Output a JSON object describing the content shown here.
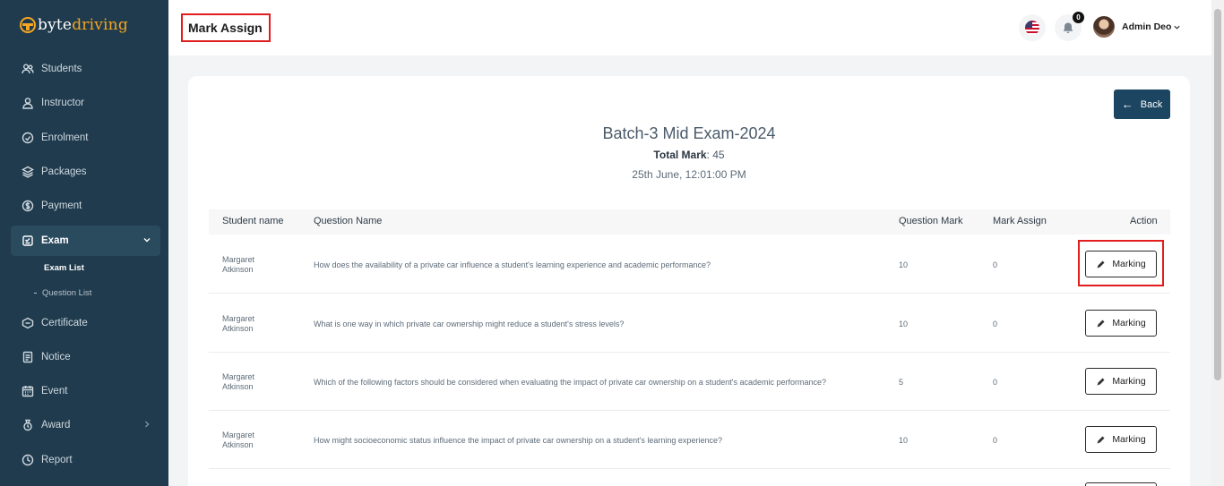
{
  "brand": {
    "part1": "byte",
    "part2": "driving"
  },
  "sidebar": {
    "items": [
      {
        "label": "Students",
        "icon": "users-icon"
      },
      {
        "label": "Instructor",
        "icon": "user-icon"
      },
      {
        "label": "Enrolment",
        "icon": "enrolment-icon"
      },
      {
        "label": "Packages",
        "icon": "layers-icon"
      },
      {
        "label": "Payment",
        "icon": "dollar-icon"
      },
      {
        "label": "Exam",
        "icon": "exam-icon"
      },
      {
        "label": "Certificate",
        "icon": "certificate-icon"
      },
      {
        "label": "Notice",
        "icon": "notice-icon"
      },
      {
        "label": "Event",
        "icon": "calendar-icon"
      },
      {
        "label": "Award",
        "icon": "award-icon"
      },
      {
        "label": "Report",
        "icon": "report-icon"
      }
    ],
    "exam_sub": [
      {
        "label": "Exam List"
      },
      {
        "label": "Question List"
      }
    ]
  },
  "header": {
    "title": "Mark Assign",
    "notification_count": "0",
    "user_name": "Admin Deo"
  },
  "main": {
    "back_label": "Back",
    "exam_title": "Batch-3 Mid Exam-2024",
    "total_mark_label": "Total Mark",
    "total_mark_value": ": 45",
    "exam_date": "25th June, 12:01:00 PM",
    "columns": [
      "Student name",
      "Question Name",
      "Question Mark",
      "Mark Assign",
      "Action"
    ],
    "rows": [
      {
        "student_first": "Margaret",
        "student_last": "Atkinson",
        "question": "How does the availability of a private car influence a student's learning experience and academic performance?",
        "question_mark": "10",
        "mark_assign": "0",
        "action": "Marking"
      },
      {
        "student_first": "Margaret",
        "student_last": "Atkinson",
        "question": "What is one way in which private car ownership might reduce a student's stress levels?",
        "question_mark": "10",
        "mark_assign": "0",
        "action": "Marking"
      },
      {
        "student_first": "Margaret",
        "student_last": "Atkinson",
        "question": "Which of the following factors should be considered when evaluating the impact of private car ownership on a student's academic performance?",
        "question_mark": "5",
        "mark_assign": "0",
        "action": "Marking"
      },
      {
        "student_first": "Margaret",
        "student_last": "Atkinson",
        "question": "How might socioeconomic status influence the impact of private car ownership on a student's learning experience?",
        "question_mark": "10",
        "mark_assign": "0",
        "action": "Marking"
      }
    ]
  },
  "colors": {
    "sidebar_bg": "#1f3b4d",
    "accent": "#f5a623",
    "back_button": "#1b4560",
    "highlight": "#e11d1d"
  }
}
